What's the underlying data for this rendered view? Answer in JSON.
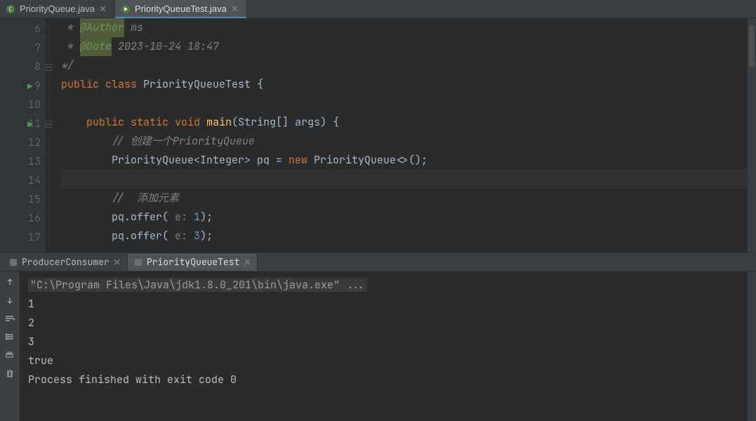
{
  "tabs": [
    {
      "label": "PriorityQueue.java"
    },
    {
      "label": "PriorityQueueTest.java"
    }
  ],
  "gutter": [
    "6",
    "7",
    "8",
    "9",
    "10",
    "11",
    "12",
    "13",
    "14",
    "15",
    "16",
    "17"
  ],
  "runGutters": [
    3,
    5
  ],
  "foldGutters": [
    2,
    5
  ],
  "code": {
    "author_tag": "@Author",
    "author_val": " ms",
    "date_tag": "@Date",
    "date_val": " 2023-10-24 18:47",
    "close": "*/",
    "l4a": "public",
    "l4b": " class",
    "l4c": " PriorityQueueTest ",
    "l4d": "{",
    "l6a": "public",
    "l6b": " static",
    "l6c": " void",
    "l6d": " main",
    "l6e": "(String[] args) ",
    "l6f": "{",
    "l7": "// 创建一个PriorityQueue",
    "l8a": "PriorityQueue<Integer> pq = ",
    "l8b": "new",
    "l8c": " PriorityQueue<>();",
    "l10": "//  添加元素",
    "l11a": "pq.offer( ",
    "l11h": "e: ",
    "l11n": "1",
    "l11c": ");",
    "l12a": "pq.offer( ",
    "l12h": "e: ",
    "l12n": "3",
    "l12c": ");"
  },
  "runTabs": [
    {
      "label": "ProducerConsumer"
    },
    {
      "label": "PriorityQueueTest"
    }
  ],
  "console": {
    "cmd": "\"C:\\Program Files\\Java\\jdk1.8.0_201\\bin\\java.exe\" ...",
    "lines": [
      "1",
      "2",
      "3",
      "true",
      "",
      "Process finished with exit code 0"
    ]
  },
  "colors": {
    "accent": "#4a88c7"
  }
}
